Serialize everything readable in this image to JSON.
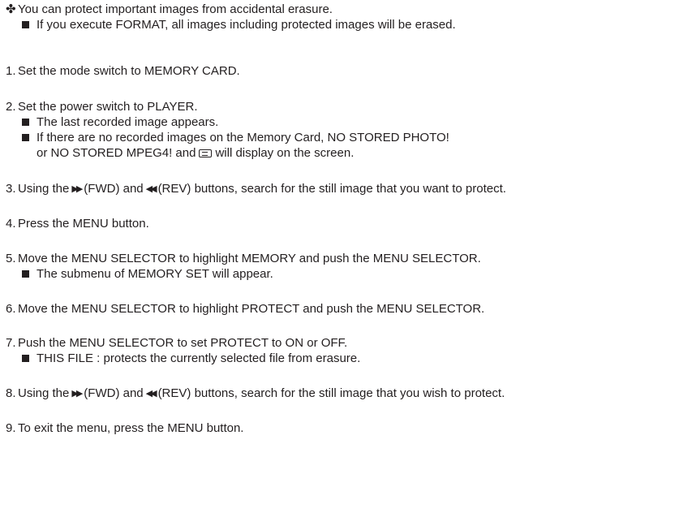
{
  "intro": {
    "bullet": "✤",
    "text": "You can protect important images from accidental erasure.",
    "note": "If you execute FORMAT, all images including protected images will be erased."
  },
  "steps": {
    "s1": {
      "num": "1.",
      "text": "Set the mode switch to MEMORY CARD."
    },
    "s2": {
      "num": "2.",
      "text": "Set the power switch to PLAYER.",
      "sub1": "The last recorded image appears.",
      "sub2": "If there are no recorded images on the Memory Card, NO STORED PHOTO!",
      "sub2_cont_a": "or NO STORED MPEG4! and",
      "sub2_cont_b": "will display on the screen."
    },
    "s3": {
      "num": "3.",
      "text_a": "Using the",
      "text_b": "(FWD) and",
      "text_c": "(REV) buttons, search for the still image that you want to protect."
    },
    "s4": {
      "num": "4.",
      "text": "Press the MENU button."
    },
    "s5": {
      "num": "5.",
      "text": "Move the MENU SELECTOR to highlight MEMORY and push the MENU SELECTOR.",
      "sub1": "The submenu of MEMORY SET will appear."
    },
    "s6": {
      "num": "6.",
      "text": "Move the MENU SELECTOR to highlight PROTECT and push the MENU SELECTOR."
    },
    "s7": {
      "num": "7.",
      "text": "Push the MENU SELECTOR to set PROTECT to ON or OFF.",
      "sub1": "THIS FILE : protects the currently selected file from erasure."
    },
    "s8": {
      "num": "8.",
      "text_a": "Using the",
      "text_b": "(FWD) and",
      "text_c": "(REV) buttons, search for the still image that you wish to protect."
    },
    "s9": {
      "num": "9.",
      "text": "To exit the menu, press the MENU button."
    }
  }
}
